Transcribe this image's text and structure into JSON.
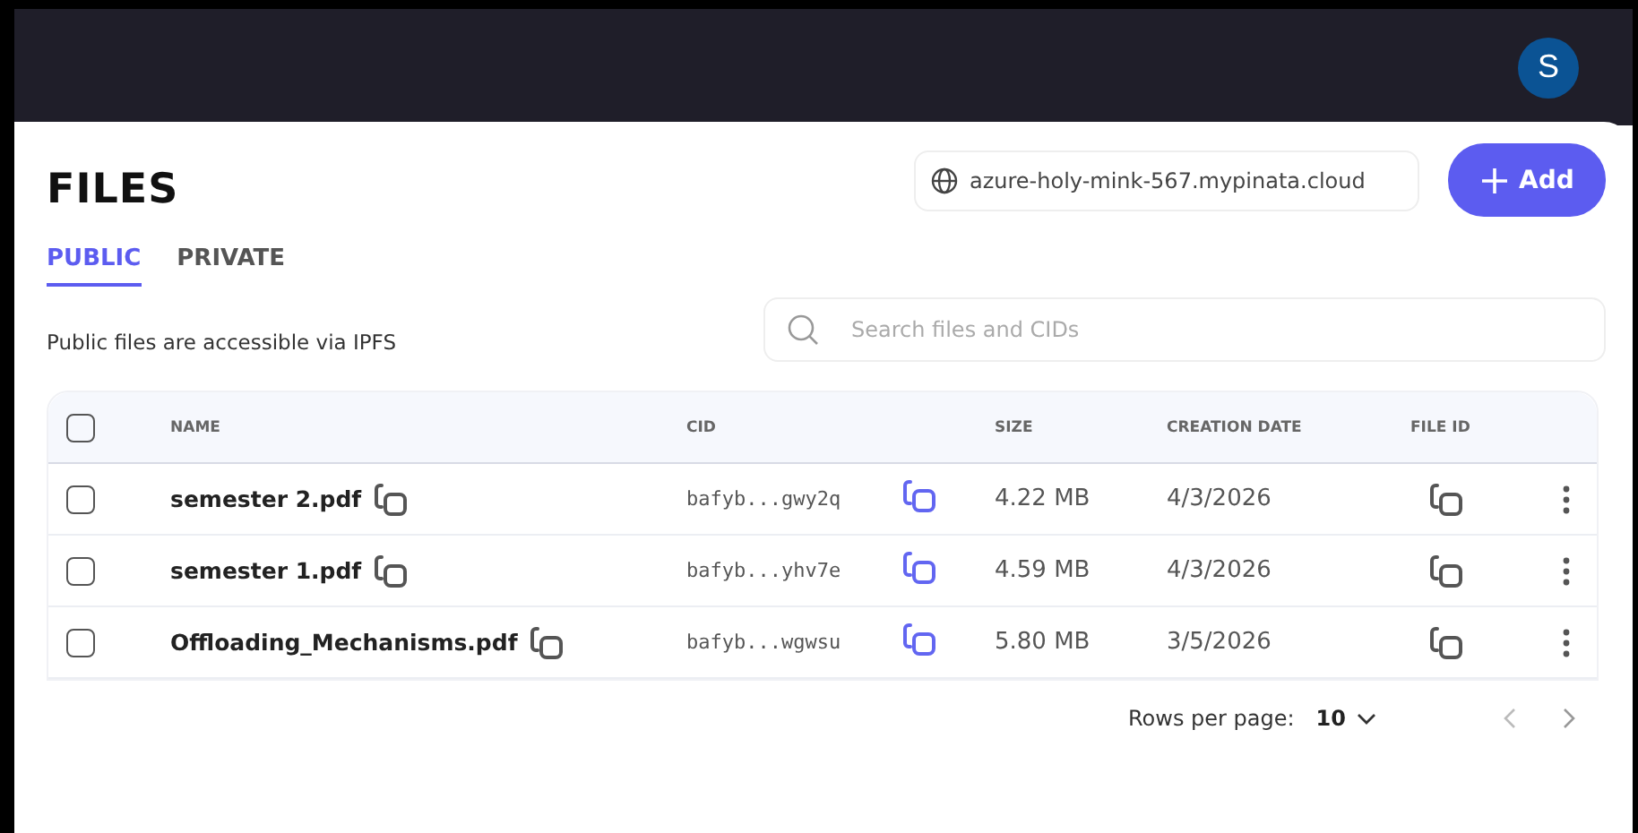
{
  "user": {
    "avatar_initial": "S"
  },
  "page": {
    "title": "FILES",
    "gateway": "azure-holy-mink-567.mypinata.cloud",
    "add_button": "Add"
  },
  "tabs": [
    {
      "label": "PUBLIC",
      "selected": true
    },
    {
      "label": "PRIVATE",
      "selected": false
    }
  ],
  "description": "Public files are accessible via IPFS",
  "search": {
    "placeholder": "Search files and CIDs"
  },
  "table": {
    "select_all_checked": false,
    "columns": [
      "NAME",
      "CID",
      "SIZE",
      "CREATION DATE",
      "FILE ID"
    ],
    "rows": [
      {
        "checked": false,
        "name": "semester 2.pdf",
        "cid": "bafyb...gwy2q",
        "size": "4.22 MB",
        "date": "4/3/2026"
      },
      {
        "checked": false,
        "name": "semester 1.pdf",
        "cid": "bafyb...yhv7e",
        "size": "4.59 MB",
        "date": "4/3/2026"
      },
      {
        "checked": false,
        "name": "Offloading_Mechanisms.pdf",
        "cid": "bafyb...wgwsu",
        "size": "5.80 MB",
        "date": "3/5/2026"
      }
    ]
  },
  "pagination": {
    "label": "Rows per page:",
    "value": "10"
  }
}
